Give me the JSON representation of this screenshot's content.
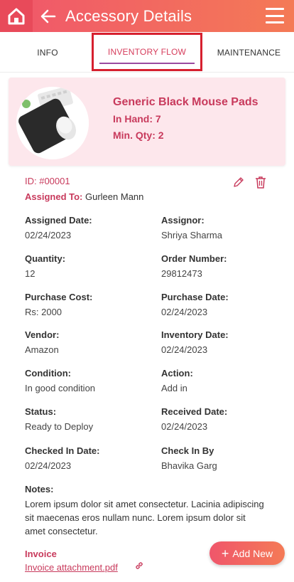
{
  "header": {
    "title": "Accessory Details"
  },
  "tabs": [
    {
      "label": "INFO"
    },
    {
      "label": "INVENTORY FLOW"
    },
    {
      "label": "MAINTENANCE"
    }
  ],
  "card": {
    "name": "Generic Black Mouse Pads",
    "in_hand": "In Hand: 7",
    "min_qty": "Min. Qty: 2"
  },
  "record": {
    "id": "ID: #00001",
    "assigned_to_label": "Assigned To:",
    "assigned_to_value": "Gurleen Mann"
  },
  "fields": [
    {
      "label": "Assigned Date:",
      "value": "02/24/2023"
    },
    {
      "label": "Assignor:",
      "value": "Shriya Sharma"
    },
    {
      "label": "Quantity:",
      "value": "12"
    },
    {
      "label": "Order Number:",
      "value": "29812473"
    },
    {
      "label": "Purchase Cost:",
      "value": "Rs: 2000"
    },
    {
      "label": "Purchase Date:",
      "value": "02/24/2023"
    },
    {
      "label": "Vendor:",
      "value": "Amazon"
    },
    {
      "label": "Inventory Date:",
      "value": "02/24/2023"
    },
    {
      "label": "Condition:",
      "value": "In good condition"
    },
    {
      "label": "Action:",
      "value": "Add in"
    },
    {
      "label": "Status:",
      "value": "Ready to Deploy"
    },
    {
      "label": "Received Date:",
      "value": "02/24/2023"
    },
    {
      "label": "Checked In Date:",
      "value": "02/24/2023"
    },
    {
      "label": "Check In By",
      "value": "Bhavika Garg"
    }
  ],
  "notes": {
    "label": "Notes:",
    "value": "Lorem ipsum dolor sit amet consectetur. Lacinia adipiscing sit maecenas eros nullam nunc. Lorem ipsum dolor sit amet consectetur."
  },
  "invoice": {
    "label": "Invoice",
    "link": "Invoice attachment.pdf"
  },
  "fab": {
    "label": "Add New"
  },
  "colors": {
    "accent": "#c83a5c",
    "header_start": "#f0566b",
    "header_end": "#f47a56",
    "card_bg": "#fde7ec",
    "highlight_border": "#d6202f"
  }
}
